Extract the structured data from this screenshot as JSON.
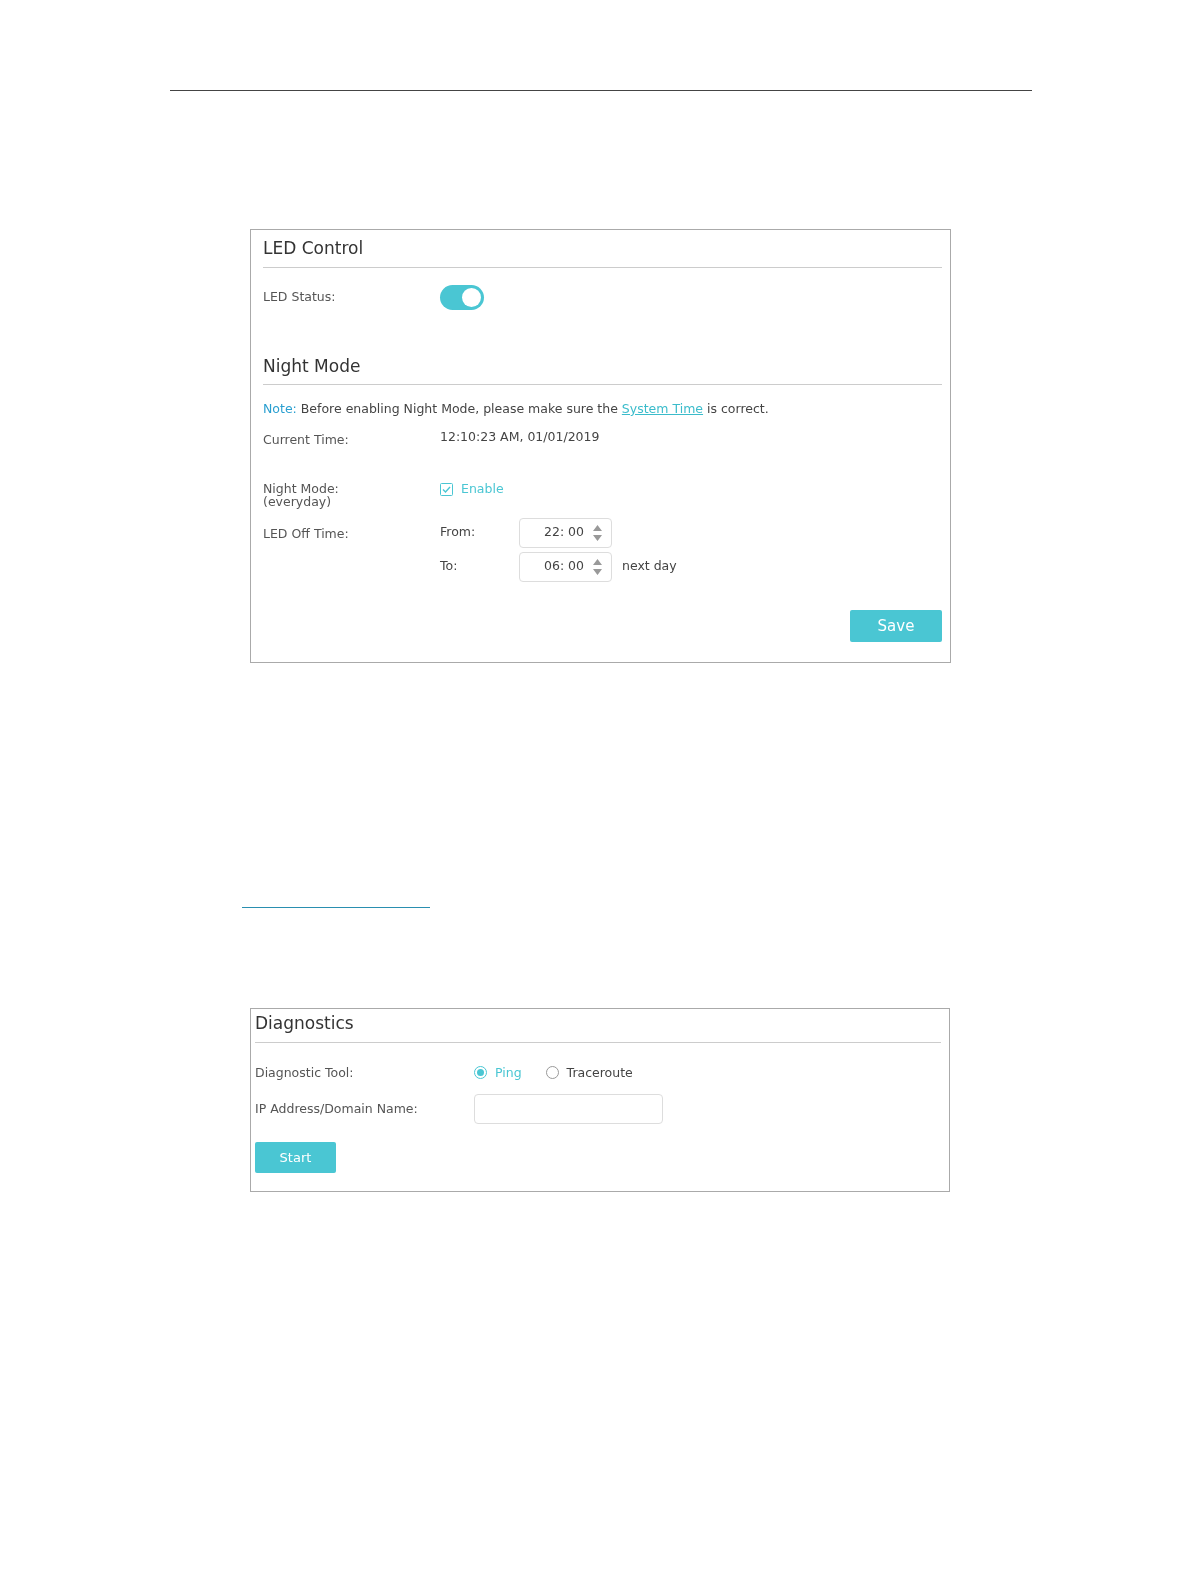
{
  "led_control": {
    "title": "LED Control",
    "led_status": {
      "label": "LED Status:",
      "on": true
    }
  },
  "night_mode": {
    "title": "Night Mode",
    "note": {
      "label": "Note:",
      "text_before": "Before enabling Night Mode, please make sure the",
      "link": "System Time",
      "text_after": "is correct."
    },
    "current_time": {
      "label": "Current Time:",
      "value": "12:10:23 AM, 01/01/2019"
    },
    "mode": {
      "label": "Night Mode:",
      "sublabel": "(everyday)",
      "checkbox_label": "Enable",
      "checked": true
    },
    "led_off_time": {
      "label": "LED Off Time:",
      "rows": [
        {
          "label": "From:",
          "value": "22: 00"
        },
        {
          "label": "To:",
          "value": "06: 00",
          "suffix": "next day"
        }
      ]
    },
    "save_button": "Save"
  },
  "diagnostics": {
    "title": "Diagnostics",
    "tool": {
      "label": "Diagnostic Tool:",
      "options": [
        {
          "label": "Ping",
          "selected": true
        },
        {
          "label": "Traceroute",
          "selected": false
        }
      ]
    },
    "address": {
      "label": "IP Address/Domain Name:"
    },
    "start_button": "Start"
  }
}
